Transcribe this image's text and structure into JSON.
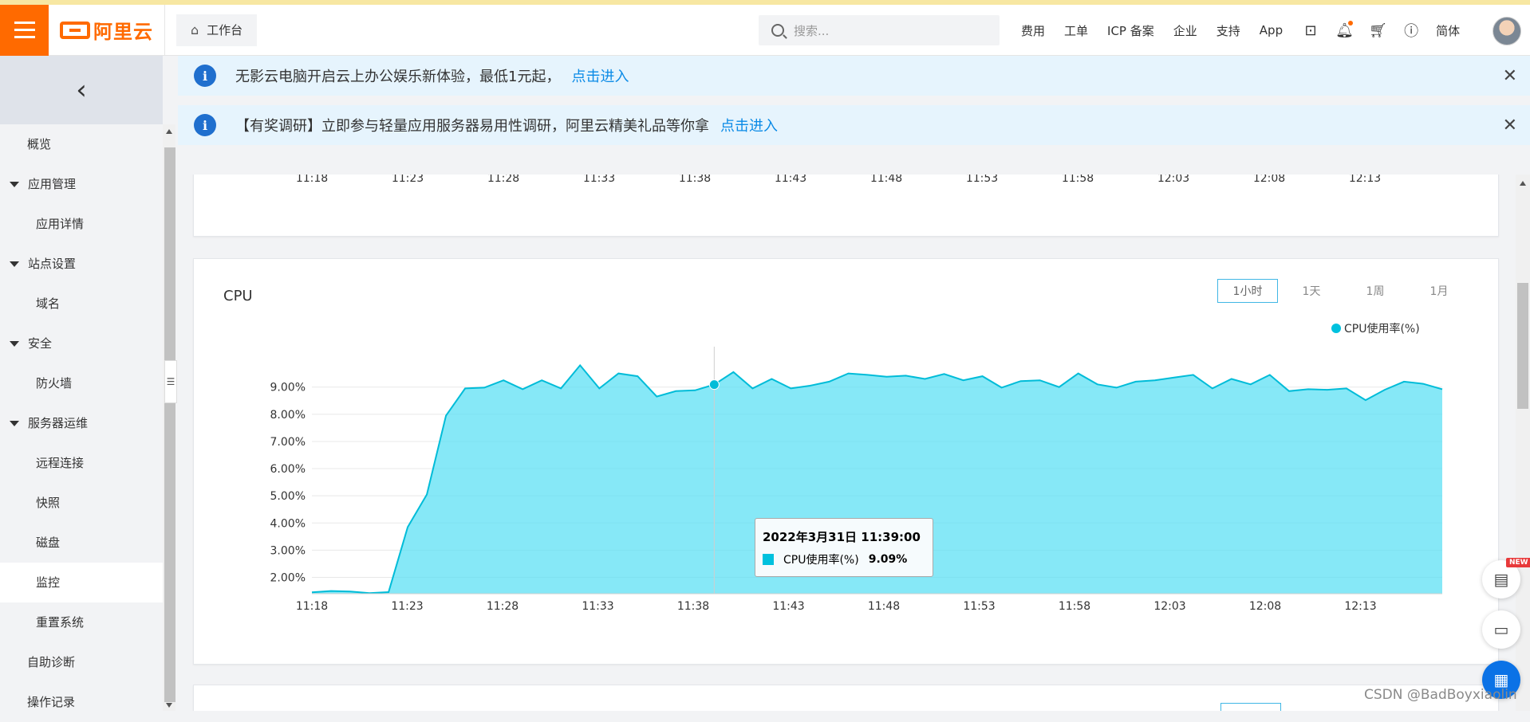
{
  "topbar": {
    "logo_text": "阿里云",
    "workbench_label": "工作台",
    "search_placeholder": "搜索...",
    "nav": [
      "费用",
      "工单",
      "ICP 备案",
      "企业",
      "支持",
      "App"
    ],
    "lang_label": "简体"
  },
  "sidebar": {
    "items": [
      {
        "label": "概览",
        "kind": "plain"
      },
      {
        "label": "应用管理",
        "kind": "group"
      },
      {
        "label": "应用详情",
        "kind": "sub"
      },
      {
        "label": "站点设置",
        "kind": "group"
      },
      {
        "label": "域名",
        "kind": "sub"
      },
      {
        "label": "安全",
        "kind": "group"
      },
      {
        "label": "防火墙",
        "kind": "sub"
      },
      {
        "label": "服务器运维",
        "kind": "group"
      },
      {
        "label": "远程连接",
        "kind": "sub"
      },
      {
        "label": "快照",
        "kind": "sub"
      },
      {
        "label": "磁盘",
        "kind": "sub"
      },
      {
        "label": "监控",
        "kind": "sub",
        "active": true
      },
      {
        "label": "重置系统",
        "kind": "sub"
      },
      {
        "label": "自助诊断",
        "kind": "plain"
      },
      {
        "label": "操作记录",
        "kind": "plain"
      }
    ]
  },
  "notices": [
    {
      "text": "无影云电脑开启云上办公娱乐新体验，最低1元起，",
      "link": "点击进入"
    },
    {
      "text": "【有奖调研】立即参与轻量应用服务器易用性调研，阿里云精美礼品等你拿",
      "link": "点击进入"
    }
  ],
  "prev_chart_ticks": [
    "11:18",
    "11:23",
    "11:28",
    "11:33",
    "11:38",
    "11:43",
    "11:48",
    "11:53",
    "11:58",
    "12:03",
    "12:08",
    "12:13"
  ],
  "cpu_card": {
    "title": "CPU",
    "ranges": [
      "1小时",
      "1天",
      "1周",
      "1月"
    ],
    "active_range": "1小时"
  },
  "chart_data": {
    "type": "area",
    "title": "CPU",
    "series": [
      {
        "name": "CPU使用率(%)",
        "color": "#00c1de",
        "values": [
          1.45,
          1.5,
          1.48,
          1.42,
          1.46,
          3.85,
          5.05,
          7.95,
          8.95,
          8.98,
          9.25,
          8.92,
          9.25,
          8.95,
          9.8,
          8.95,
          9.5,
          9.4,
          8.65,
          8.85,
          8.88,
          9.09,
          9.55,
          8.95,
          9.3,
          8.95,
          9.05,
          9.2,
          9.5,
          9.45,
          9.38,
          9.42,
          9.3,
          9.48,
          9.25,
          9.4,
          8.98,
          9.22,
          9.25,
          9.0,
          9.5,
          9.1,
          8.98,
          9.2,
          9.25,
          9.35,
          9.45,
          8.95,
          9.3,
          9.1,
          9.45,
          8.85,
          8.92,
          8.9,
          8.95,
          8.52,
          8.9,
          9.2,
          9.12,
          8.92
        ]
      }
    ],
    "x_tick_labels": [
      "11:18",
      "11:23",
      "11:28",
      "11:33",
      "11:38",
      "11:43",
      "11:48",
      "11:53",
      "11:58",
      "12:03",
      "12:08",
      "12:13"
    ],
    "y_tick_labels": [
      "2.00%",
      "3.00%",
      "4.00%",
      "5.00%",
      "6.00%",
      "7.00%",
      "8.00%",
      "9.00%"
    ],
    "ylim": [
      1.4,
      9.9
    ],
    "grid": true,
    "legend_position": "top-right",
    "hover_index": 21
  },
  "tooltip": {
    "title": "2022年3月31日 11:39:00",
    "series_label": "CPU使用率(%)",
    "value": "9.09%"
  },
  "watermark": "CSDN @BadBoyxiaolin"
}
